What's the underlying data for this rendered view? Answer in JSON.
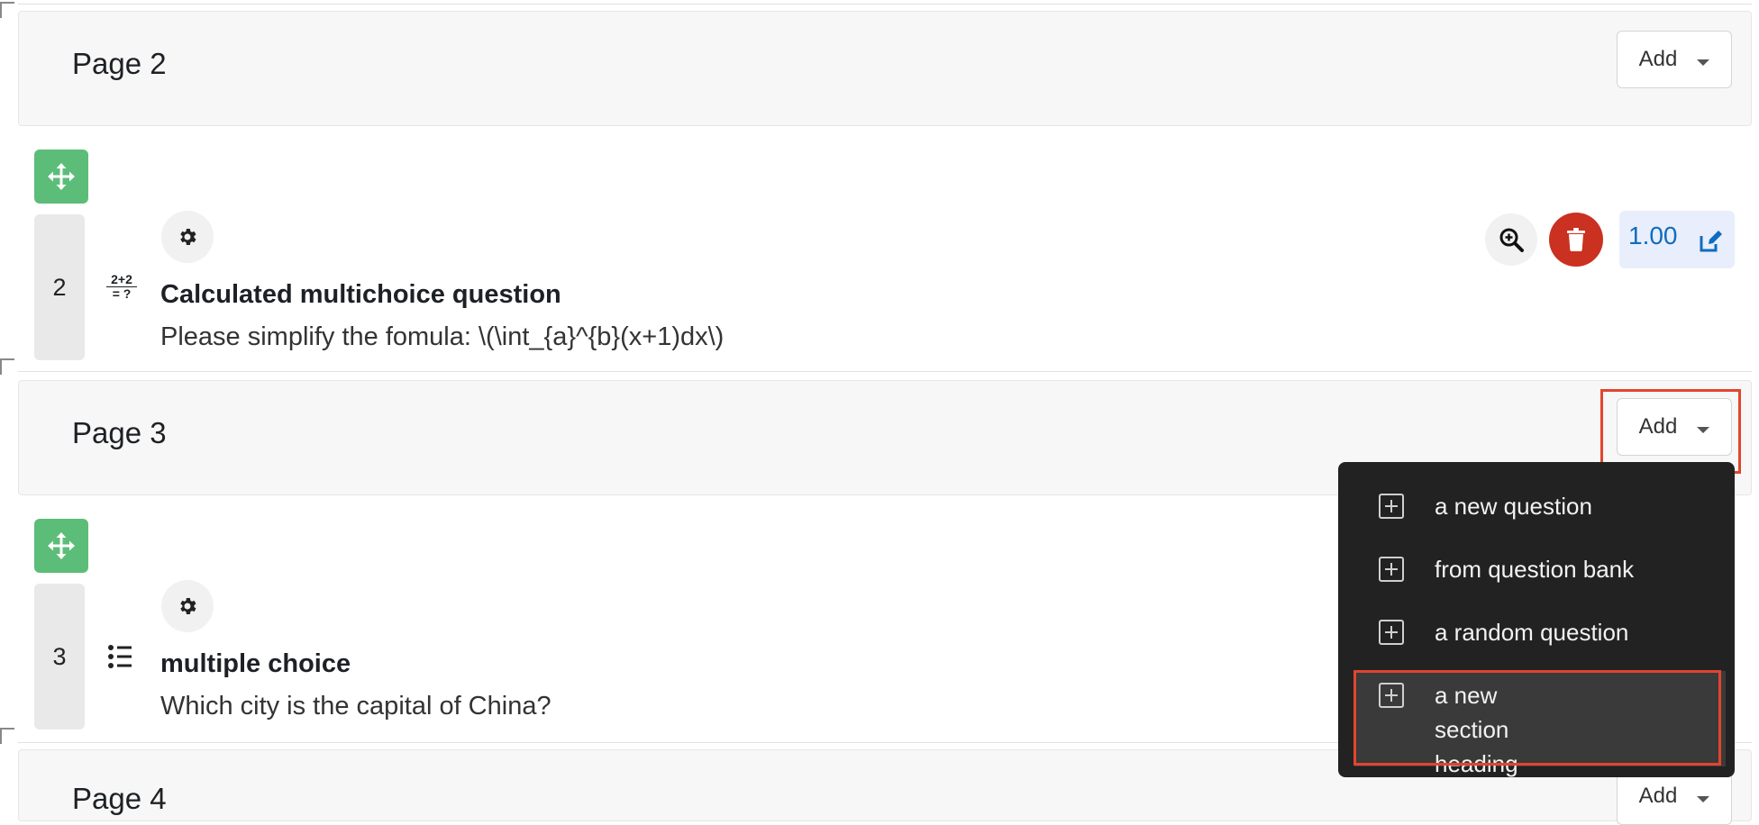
{
  "pages": [
    {
      "title": "Page 2",
      "add_label": "Add"
    },
    {
      "title": "Page 3",
      "add_label": "Add"
    },
    {
      "title": "Page 4",
      "add_label": "Add"
    }
  ],
  "questions": [
    {
      "slot": "2",
      "type_icon": "calculated-icon",
      "type_icon_text_top": "2+2",
      "type_icon_text_bottom": "= ?",
      "title": "Calculated multichoice question",
      "text": "Please simplify the fomula: \\(\\int_{a}^{b}(x+1)dx\\)",
      "mark": "1.00"
    },
    {
      "slot": "3",
      "type_icon": "list-icon",
      "title": "multiple choice",
      "text": "Which city is the capital of China?"
    }
  ],
  "add_menu": {
    "items": [
      "a new question",
      "from question bank",
      "a random question",
      "a new section heading"
    ]
  },
  "colors": {
    "move_button": "#5cbd78",
    "delete_button": "#ca3120",
    "mark_text": "#0f6cbf",
    "menu_bg": "#222222",
    "highlight": "#e2452e"
  }
}
